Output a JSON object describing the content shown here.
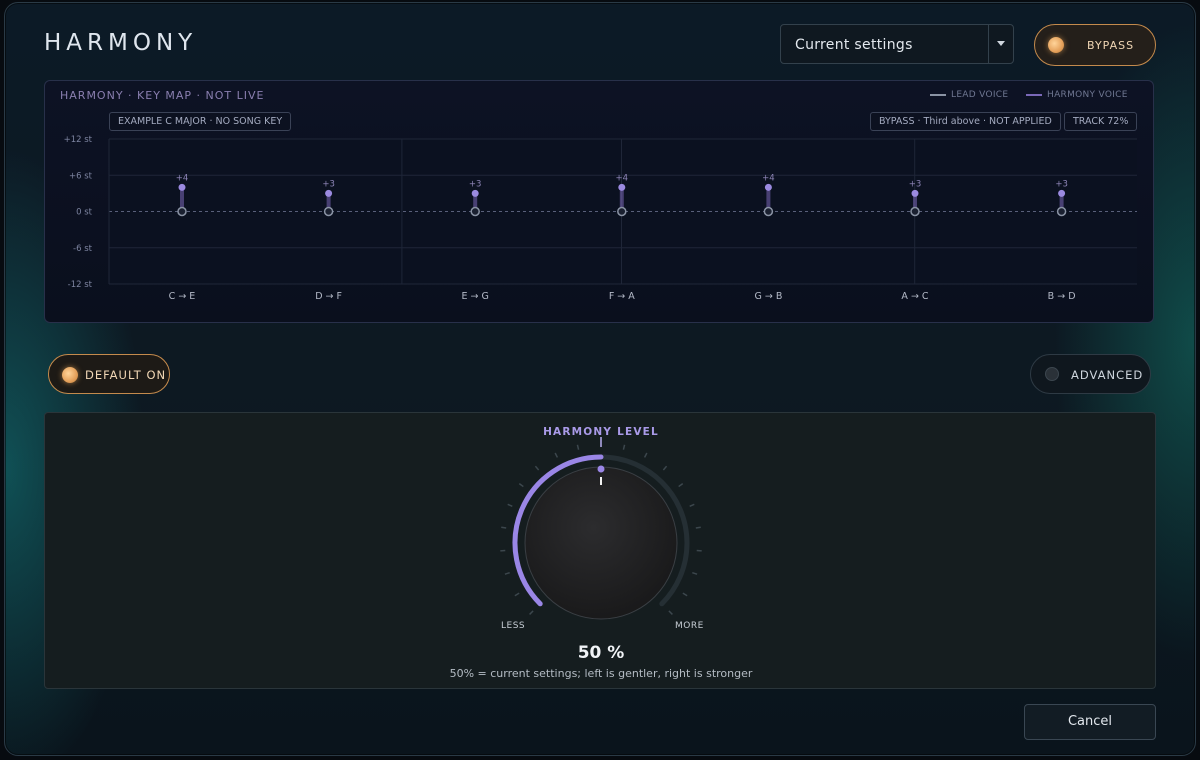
{
  "header": {
    "title": "HARMONY",
    "preset": {
      "value": "Current settings"
    },
    "bypass_label": "BYPASS"
  },
  "key_map": {
    "title": "HARMONY · KEY MAP · NOT LIVE",
    "legend": {
      "lead": "LEAD VOICE",
      "harmony": "HARMONY VOICE"
    },
    "chips": {
      "example": "EXAMPLE C MAJOR · NO SONG KEY",
      "bypass_status": "BYPASS · Third above · NOT APPLIED",
      "track": "TRACK 72%"
    },
    "colors": {
      "lead": "#8a93a4",
      "harmony": "#7a68b8",
      "accent": "#9b8ae0"
    }
  },
  "chart_data": {
    "type": "scatter",
    "categories": [
      "C → E",
      "D → F",
      "E → G",
      "F → A",
      "G → B",
      "A → C",
      "B → D"
    ],
    "series": [
      {
        "name": "LEAD VOICE",
        "values": [
          0,
          0,
          0,
          0,
          0,
          0,
          0
        ]
      },
      {
        "name": "HARMONY VOICE",
        "values": [
          4,
          3,
          3,
          4,
          4,
          3,
          3
        ]
      }
    ],
    "point_labels": [
      "+4",
      "+3",
      "+3",
      "+4",
      "+4",
      "+3",
      "+3"
    ],
    "y_ticks": [
      "+12 st",
      "+6 st",
      "0 st",
      "-6 st",
      "-12 st"
    ],
    "y_tick_values": [
      12,
      6,
      0,
      -6,
      -12
    ],
    "ylim": [
      -12,
      12
    ],
    "grid": true
  },
  "controls": {
    "default_label": "DEFAULT ON",
    "advanced_label": "ADVANCED"
  },
  "knob": {
    "title": "HARMONY LEVEL",
    "less_label": "LESS",
    "more_label": "MORE",
    "value_text": "50 %",
    "value": 0.5,
    "help": "50% = current settings; left is gentler, right is stronger",
    "accent_color": "#9a86e6"
  },
  "footer": {
    "cancel_label": "Cancel"
  }
}
